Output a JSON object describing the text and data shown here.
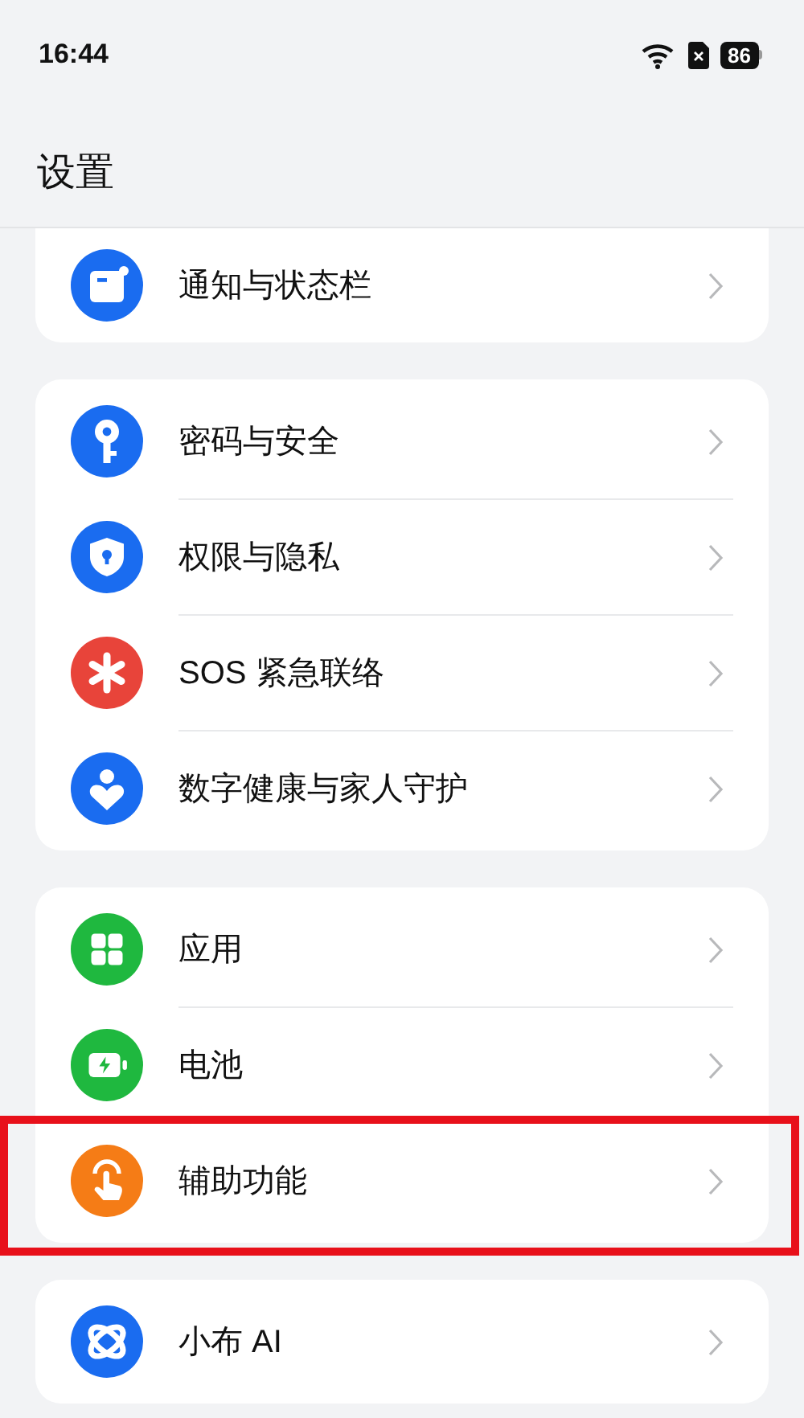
{
  "status_bar": {
    "time": "16:44",
    "battery": "86"
  },
  "title": "设置",
  "groups": [
    {
      "items": [
        {
          "label": "通知与状态栏",
          "color": "#1a6cf0",
          "highlighted": false
        }
      ]
    },
    {
      "items": [
        {
          "label": "密码与安全",
          "color": "#1a6cf0",
          "highlighted": false
        },
        {
          "label": "权限与隐私",
          "color": "#1a6cf0",
          "highlighted": false
        },
        {
          "label": "SOS 紧急联络",
          "color": "#e8443a",
          "highlighted": false
        },
        {
          "label": "数字健康与家人守护",
          "color": "#1a6cf0",
          "highlighted": false
        }
      ]
    },
    {
      "items": [
        {
          "label": "应用",
          "color": "#1fb83f",
          "highlighted": false
        },
        {
          "label": "电池",
          "color": "#1fb83f",
          "highlighted": false
        },
        {
          "label": "辅助功能",
          "color": "#f57c16",
          "highlighted": true
        }
      ]
    },
    {
      "items": [
        {
          "label": "小布 AI",
          "color": "#1a6cf0",
          "highlighted": false
        }
      ]
    }
  ]
}
